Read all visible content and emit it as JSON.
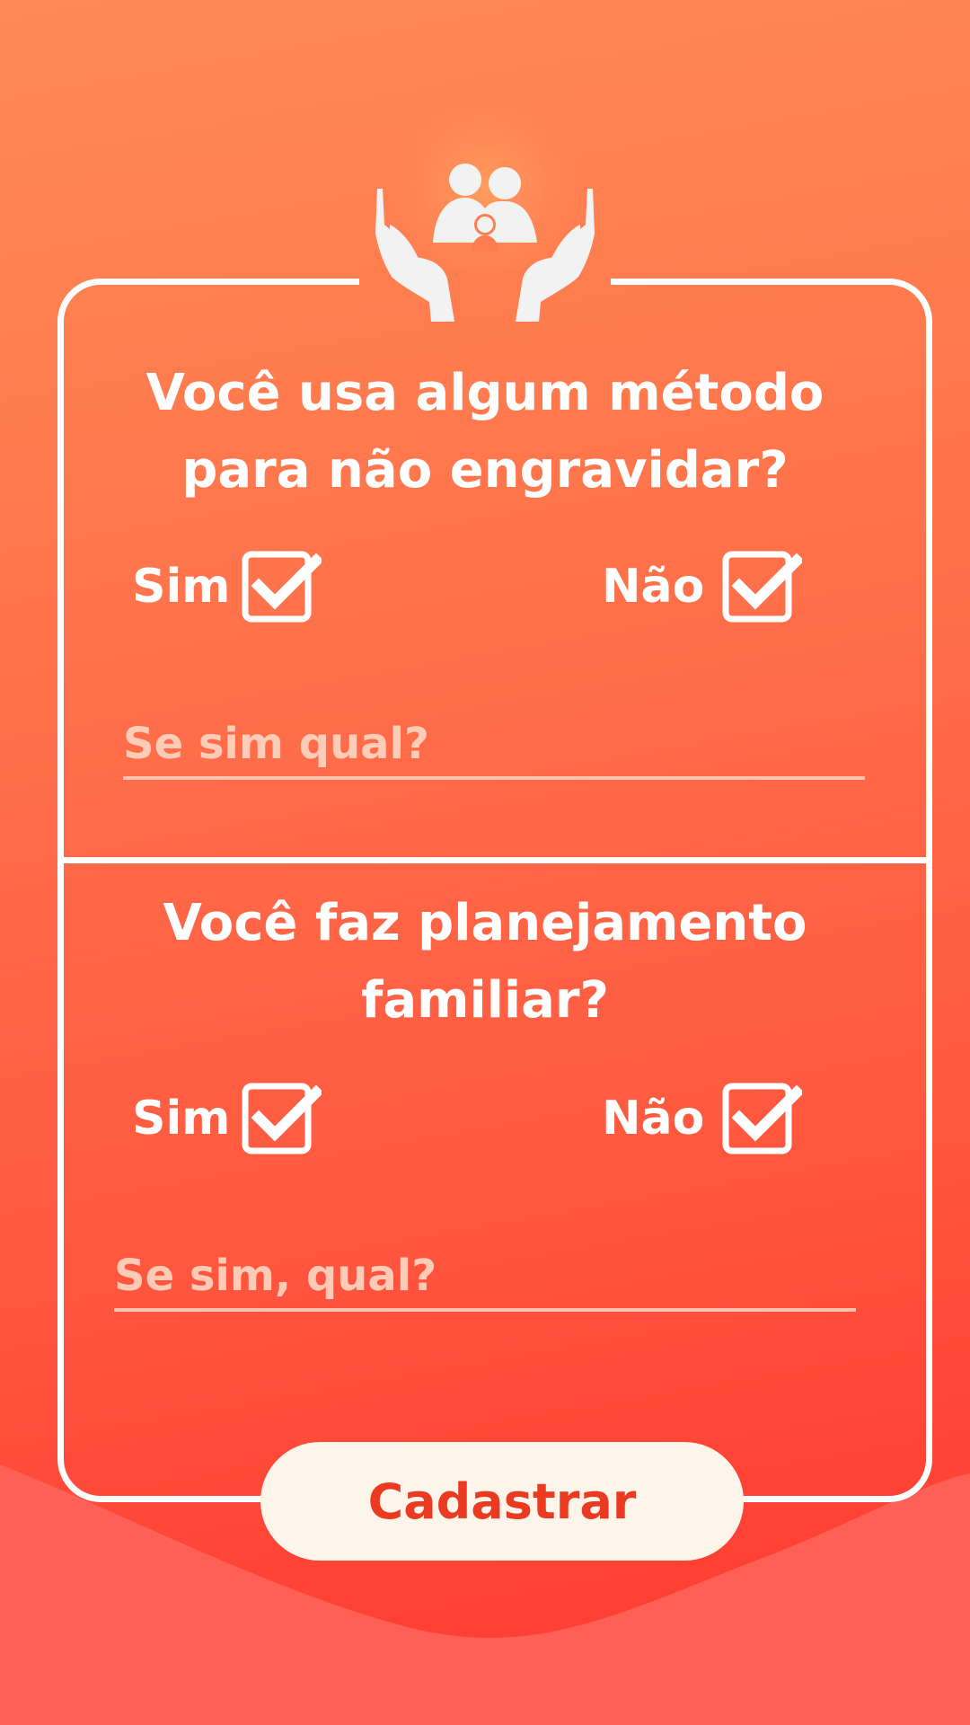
{
  "form": {
    "q1": {
      "question": "Você usa algum método para não engravidar?",
      "option_yes": "Sim",
      "option_no": "Não",
      "detail_placeholder": "Se sim qual?"
    },
    "q2": {
      "question": "Você faz planejamento familiar?",
      "option_yes": "Sim",
      "option_no": "Não",
      "detail_placeholder": "Se sim, qual?"
    },
    "submit_label": "Cadastrar"
  },
  "icons": {
    "logo": "family-in-hands-icon",
    "checkbox": "checkbox-checked-icon"
  },
  "colors": {
    "background_top": "#ff8a55",
    "background_bottom": "#ff3a30",
    "button_bg": "#fdf5ea",
    "button_text": "#ea3a22",
    "foreground": "#ffffff"
  }
}
